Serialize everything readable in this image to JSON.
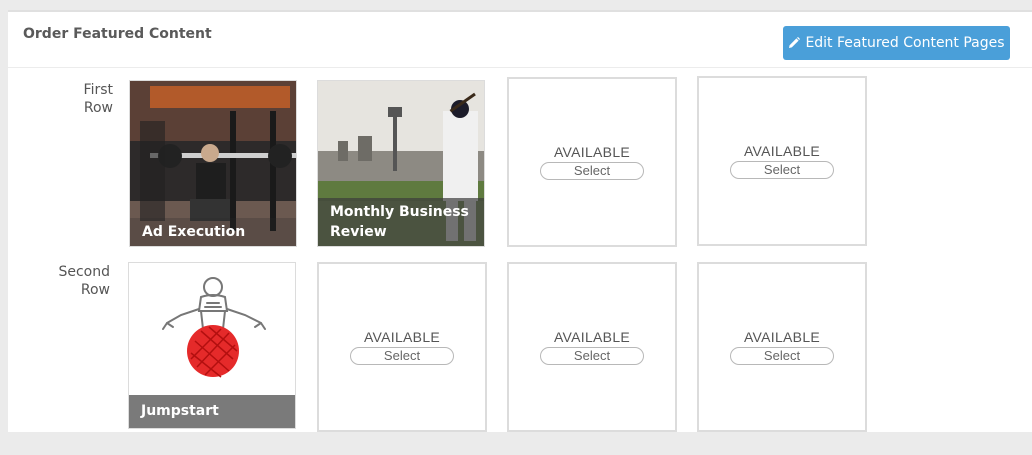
{
  "header": {
    "title": "Order Featured Content",
    "edit_button_label": "Edit Featured Content Pages",
    "edit_icon": "pencil-icon"
  },
  "rows": [
    {
      "label_line1": "First",
      "label_line2": "Row",
      "tiles": [
        {
          "type": "image",
          "caption": "Ad Execution",
          "image": "gym-squat-photo"
        },
        {
          "type": "image",
          "caption_line1": "Monthly Business",
          "caption_line2": "Review",
          "image": "baseball-stadium-photo"
        },
        {
          "type": "available",
          "label": "AVAILABLE",
          "select": "Select"
        },
        {
          "type": "available",
          "label": "AVAILABLE",
          "select": "Select"
        }
      ]
    },
    {
      "label_line1": "Second",
      "label_line2": "Row",
      "tiles": [
        {
          "type": "image",
          "caption": "Jumpstart",
          "image": "figure-on-red-ball-drawing"
        },
        {
          "type": "available",
          "label": "AVAILABLE",
          "select": "Select"
        },
        {
          "type": "available",
          "label": "AVAILABLE",
          "select": "Select"
        },
        {
          "type": "available",
          "label": "AVAILABLE",
          "select": "Select"
        }
      ]
    }
  ],
  "colors": {
    "accent": "#4a9fd9",
    "caption_overlay": "#555555"
  }
}
